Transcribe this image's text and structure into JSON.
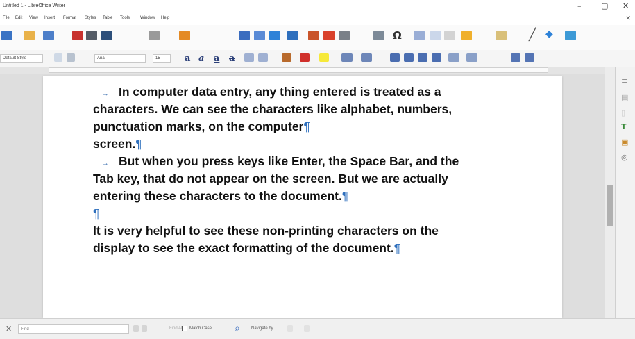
{
  "window": {
    "title": "Untitled 1 - LibreOffice Writer",
    "minimize": "–",
    "maximize": "▢",
    "close": "✕"
  },
  "menu": [
    "File",
    "Edit",
    "View",
    "Insert",
    "Format",
    "Styles",
    "Table",
    "Tools",
    "Window",
    "Help"
  ],
  "formatting": {
    "paragraph_style": "Default Style",
    "font_name": "Arial",
    "font_size": "15",
    "bold": "a",
    "italic": "a",
    "underline": "a",
    "strikethrough": "a"
  },
  "document": {
    "paragraphs": [
      {
        "lines": [
          "In computer data entry, any thing entered is treated as a",
          "characters. We can see the characters like alphabet, numbers,",
          "punctuation marks, on the computer"
        ]
      },
      {
        "lines": [
          "screen."
        ]
      },
      {
        "lines": [
          "But when you press keys like Enter, the Space Bar, and the",
          "Tab key, that do not appear on the screen. But we are actually",
          "entering these characters to the document."
        ]
      },
      {
        "lines": [
          ""
        ]
      },
      {
        "lines": [
          "It is very helpful to see these non-printing characters on the",
          "display to see the exact formatting of the document."
        ]
      }
    ],
    "pilcrow": "¶",
    "tab_mark": "→"
  },
  "findbar": {
    "close": "✕",
    "find_placeholder": "Find",
    "find_all": "Find All",
    "match_case": "Match Case",
    "navigate_by": "Navigate by"
  },
  "icons": [
    "save-icon",
    "undo-icon",
    "redo-icon",
    "spellcheck-icon",
    "special-character-icon",
    "insert-table-icon",
    "properties-icon",
    "styles-icon",
    "gallery-icon",
    "navigator-icon"
  ],
  "colors": {
    "accent": "#2e6fbd",
    "font_color_underline": "#d0302b",
    "highlight": "#f6e93a"
  }
}
